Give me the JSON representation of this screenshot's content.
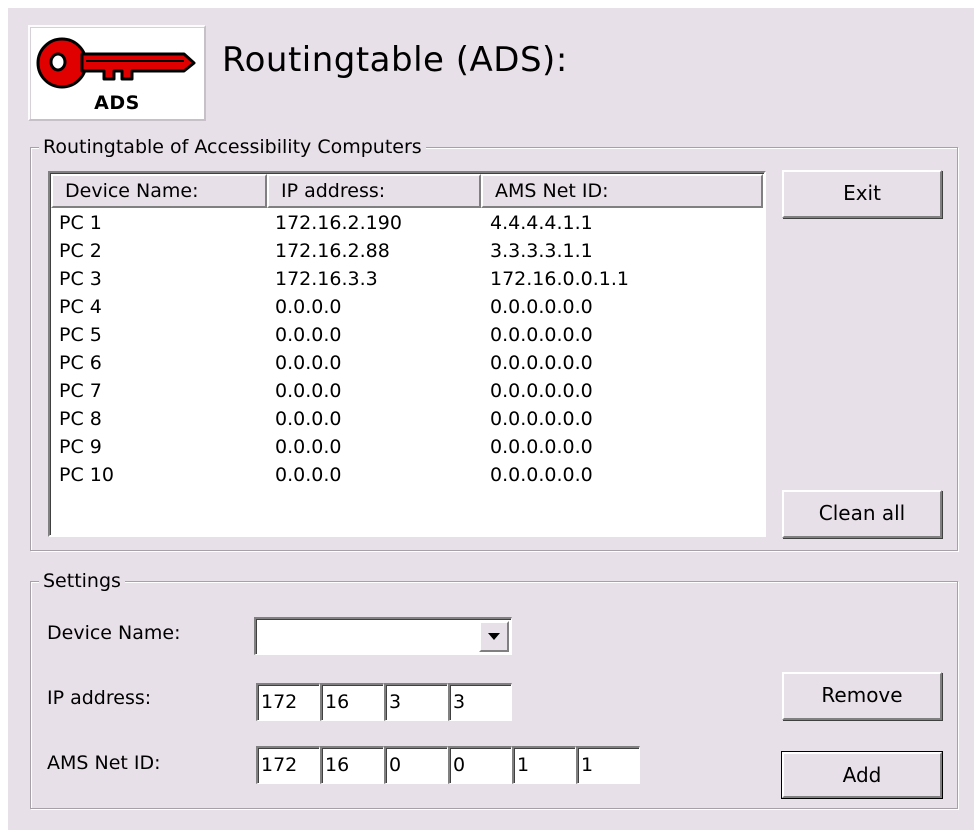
{
  "header": {
    "logo_text": "ADS",
    "title": "Routingtable (ADS):"
  },
  "routing_group": {
    "legend": "Routingtable of Accessibility Computers",
    "columns": [
      "Device Name:",
      "IP address:",
      "AMS Net ID:"
    ],
    "rows": [
      [
        "PC 1",
        "172.16.2.190",
        "4.4.4.4.1.1"
      ],
      [
        "PC 2",
        "172.16.2.88",
        "3.3.3.3.1.1"
      ],
      [
        "PC 3",
        "172.16.3.3",
        "172.16.0.0.1.1"
      ],
      [
        "PC 4",
        "0.0.0.0",
        "0.0.0.0.0.0"
      ],
      [
        "PC 5",
        "0.0.0.0",
        "0.0.0.0.0.0"
      ],
      [
        "PC 6",
        "0.0.0.0",
        "0.0.0.0.0.0"
      ],
      [
        "PC 7",
        "0.0.0.0",
        "0.0.0.0.0.0"
      ],
      [
        "PC 8",
        "0.0.0.0",
        "0.0.0.0.0.0"
      ],
      [
        "PC 9",
        "0.0.0.0",
        "0.0.0.0.0.0"
      ],
      [
        "PC 10",
        "0.0.0.0",
        "0.0.0.0.0.0"
      ]
    ],
    "exit_label": "Exit",
    "clean_all_label": "Clean all"
  },
  "settings": {
    "legend": "Settings",
    "device_name_label": "Device Name:",
    "device_name_value": "",
    "ip_label": "IP address:",
    "ip_octets": [
      "172",
      "16",
      "3",
      "3"
    ],
    "ams_label": "AMS Net ID:",
    "ams_octets": [
      "172",
      "16",
      "0",
      "0",
      "1",
      "1"
    ],
    "remove_label": "Remove",
    "add_label": "Add"
  },
  "colors": {
    "window_bg": "#e8e0e8",
    "key_red": "#e00000"
  },
  "icons": {
    "logo": "key-icon",
    "combo_arrow": "chevron-down-icon"
  }
}
